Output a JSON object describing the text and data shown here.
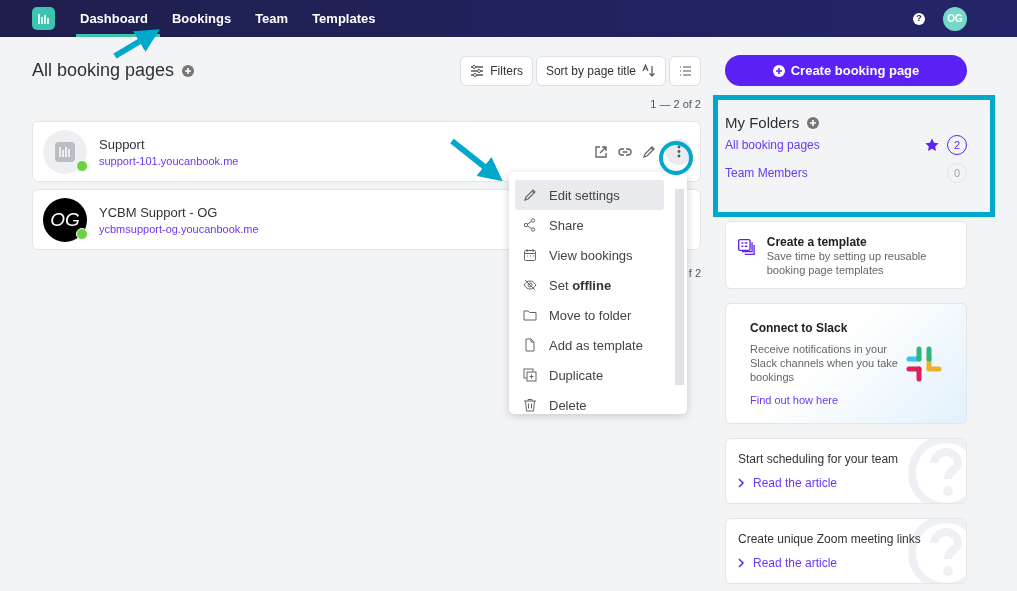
{
  "nav": {
    "tabs": [
      {
        "label": "Dashboard",
        "selected": true
      },
      {
        "label": "Bookings",
        "selected": false
      },
      {
        "label": "Team",
        "selected": false
      },
      {
        "label": "Templates",
        "selected": false
      }
    ],
    "avatar": "OG",
    "help_icon": "?"
  },
  "header": {
    "title": "All booking pages",
    "filters": "Filters",
    "sort": "Sort by page title"
  },
  "pagination_top": "1 — 2 of 2",
  "pages": [
    {
      "name": "Support",
      "url": "support-101.youcanbook.me",
      "kind": "logo",
      "online": true,
      "show_actions": true
    },
    {
      "name": "YCBM Support - OG",
      "url": "ycbmsupport-og.youcanbook.me",
      "kind": "initials",
      "avatar_text": "OG",
      "online": true,
      "show_actions": false
    }
  ],
  "pagination_bottom": "f 2",
  "menu": {
    "items": [
      {
        "label": "Edit settings",
        "selected": true
      },
      {
        "label": "Share",
        "selected": false
      },
      {
        "label": "View bookings",
        "selected": false
      },
      {
        "label": "Set **offline**",
        "selected": false
      },
      {
        "label": "Move to folder",
        "selected": false
      },
      {
        "label": "Add as template",
        "selected": false
      },
      {
        "label": "Duplicate",
        "selected": false
      },
      {
        "label": "Delete",
        "selected": false
      }
    ]
  },
  "sidebar": {
    "create_button": "Create booking page",
    "folders": {
      "title": "My Folders",
      "items": [
        {
          "name": "All booking pages",
          "count": "2",
          "starred": true,
          "selected": true
        },
        {
          "name": "Team Members",
          "count": "0",
          "starred": false,
          "selected": false
        }
      ]
    },
    "template_card": {
      "title": "Create a template",
      "text": "Save time by setting up reusable booking page templates"
    },
    "slack_card": {
      "title": "Connect to Slack",
      "text": "Receive notifications in your Slack channels when you take bookings",
      "link": "Find out how here"
    },
    "articles": [
      {
        "title": "Start scheduling for your team",
        "link": "Read the article"
      },
      {
        "title": "Create unique Zoom meeting links",
        "link": "Read the article"
      }
    ]
  }
}
